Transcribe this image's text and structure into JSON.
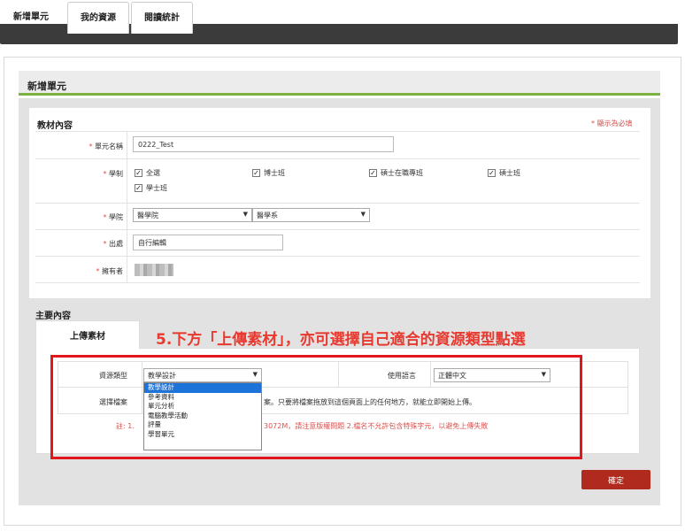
{
  "tabs": [
    {
      "label": "新增單元"
    },
    {
      "label": "我的資源"
    },
    {
      "label": "閱讀統計"
    }
  ],
  "header": {
    "title": "新增單元"
  },
  "material": {
    "section_title": "教材內容",
    "required_note": "* 顯示為必填",
    "fields": {
      "unit_name_label": "單元名稱",
      "unit_name_value": "0222_Test",
      "system_label": "學制",
      "system_options": [
        "全選",
        "博士班",
        "碩士在職專班",
        "碩士班",
        "學士班"
      ],
      "college_label": "學院",
      "college_value": "醫學院",
      "dept_value": "醫學系",
      "source_label": "出處",
      "source_value": "自行編輯",
      "owner_label": "擁有者"
    }
  },
  "main": {
    "section_title": "主要內容",
    "upload_tab": "上傳素材",
    "annotation": "5.下方「上傳素材」，亦可選擇自己適合的資源類型點選",
    "resource_type_label": "資源類型",
    "resource_type_value": "教學設計",
    "language_label": "使用語言",
    "language_value": "正體中文",
    "choose_file_label": "選擇檔案",
    "drop_hint": "案。只要將檔案拖放到這個頁面上的任何地方，就能立即開始上傳。",
    "note_prefix": "註: 1.",
    "note_rest": "3072M，請注意版權問題 2.檔名不允許包含特殊字元，以避免上傳失敗",
    "dropdown_options": [
      "教學設計",
      "參考資料",
      "單元分析",
      "電腦教學活動",
      "評量",
      "學習單元"
    ],
    "confirm_label": "確定"
  },
  "colors": {
    "accent_green": "#7bb241",
    "required_red": "#d9534f",
    "annotation_red": "#e8392f",
    "confirm_button": "#b02b1d",
    "dropdown_selected": "#1e73d8"
  }
}
